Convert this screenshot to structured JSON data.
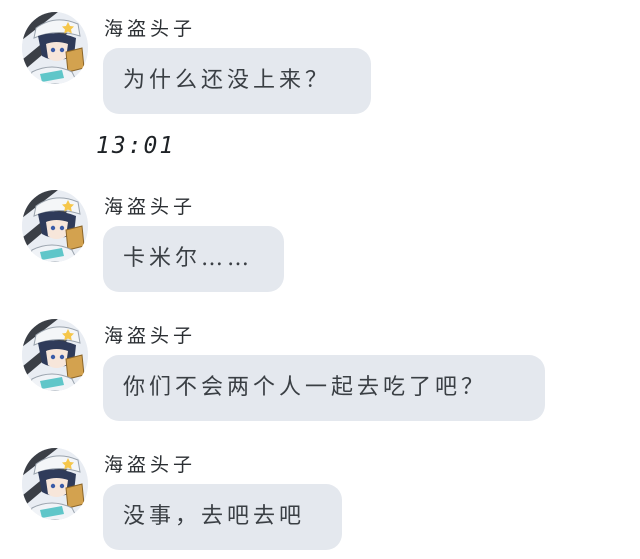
{
  "messages": [
    {
      "sender": "海盗头子",
      "text": "为什么还没上来？",
      "avatar_icon": "anime-avatar-icon"
    },
    {
      "sender": "海盗头子",
      "text": "卡米尔……",
      "avatar_icon": "anime-avatar-icon"
    },
    {
      "sender": "海盗头子",
      "text": "你们不会两个人一起去吃了吧？",
      "avatar_icon": "anime-avatar-icon"
    },
    {
      "sender": "海盗头子",
      "text": "没事，去吧去吧",
      "avatar_icon": "anime-avatar-icon"
    }
  ],
  "timestamp": "13:01",
  "colors": {
    "bubble": "#e4e8ee",
    "background": "#ffffff",
    "text": "#3a3f44"
  }
}
